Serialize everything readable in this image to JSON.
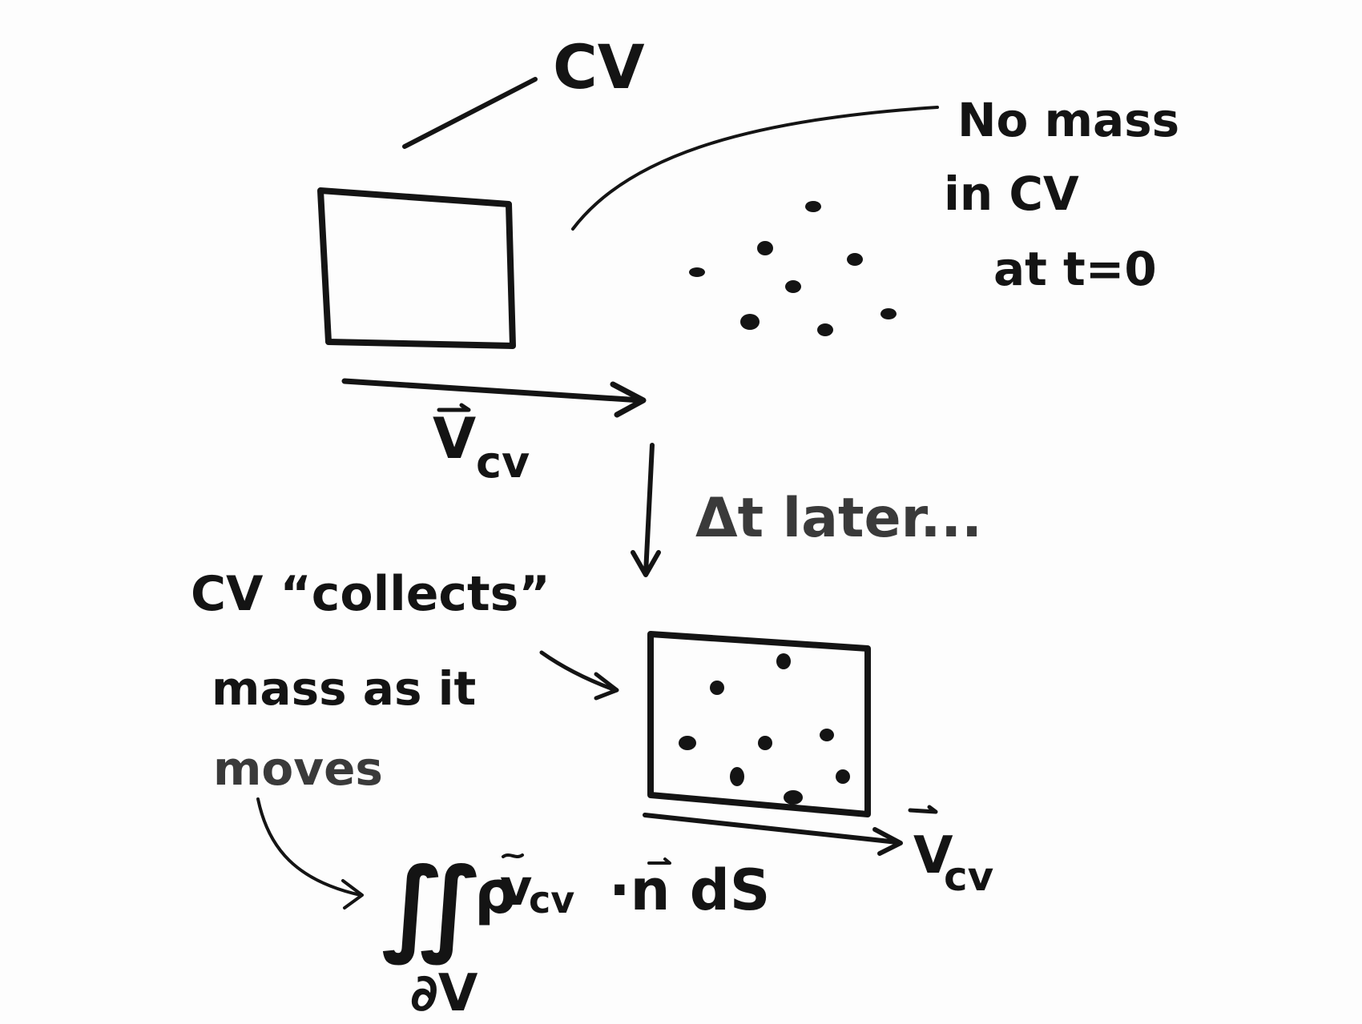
{
  "labels": {
    "cv_top": "CV",
    "no_mass_line1": "No mass",
    "no_mass_line2": "in CV",
    "no_mass_line3": "at t=0",
    "v_cv_top_symbol": "V",
    "v_cv_top_sub": "cv",
    "delta_t": "Δt later...",
    "collects_line1": "CV “collects”",
    "collects_line2": "mass as it",
    "collects_line3": "moves",
    "v_cv_bottom_symbol": "V",
    "v_cv_bottom_sub": "cv",
    "integral_sign": "∬",
    "integral_body": "ρ",
    "integral_v": "v",
    "integral_v_sub": "cv",
    "integral_dot_n": "·n dS",
    "integral_domain": "∂V"
  }
}
